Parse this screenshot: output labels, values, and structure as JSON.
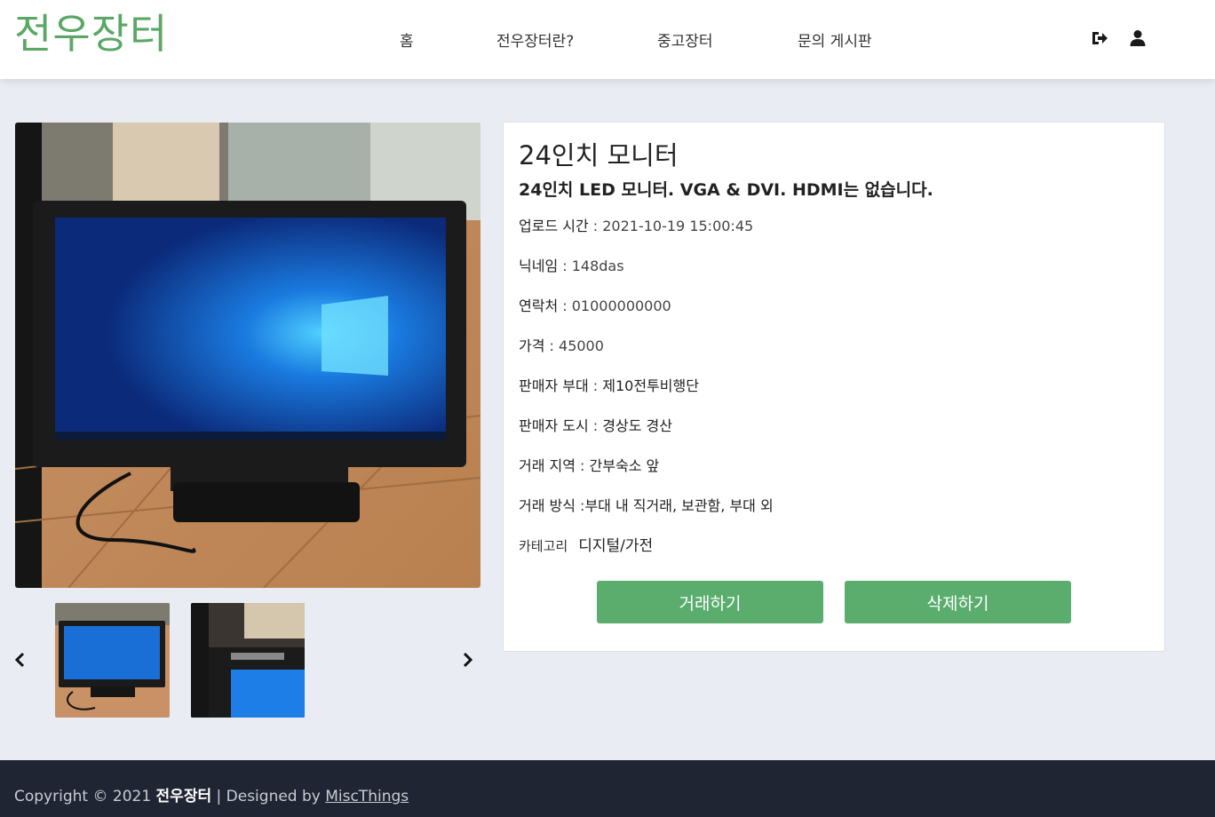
{
  "header": {
    "logo": "전우장터",
    "nav": [
      {
        "label": "홈"
      },
      {
        "label": "전우장터란?"
      },
      {
        "label": "중고장터"
      },
      {
        "label": "문의 게시판"
      }
    ],
    "icons": [
      "logout-icon",
      "user-icon"
    ]
  },
  "gallery": {
    "thumbnails": [
      "monitor-photo-1",
      "monitor-photo-2"
    ],
    "prev_icon": "chevron-left-icon",
    "next_icon": "chevron-right-icon"
  },
  "product": {
    "title": "24인치 모니터",
    "subtitle": "24인치 LED 모니터. VGA & DVI. HDMI는 없습니다.",
    "fields": [
      {
        "label": "업로드 시간",
        "sep": " : ",
        "value": "2021-10-19 15:00:45"
      },
      {
        "label": "닉네임",
        "sep": " : ",
        "value": "148das"
      },
      {
        "label": "연락처",
        "sep": " : ",
        "value": "01000000000"
      },
      {
        "label": "가격",
        "sep": " : ",
        "value": "45000"
      },
      {
        "label": "판매자 부대",
        "sep": " : ",
        "value": "제10전투비행단"
      },
      {
        "label": "판매자 도시",
        "sep": " : ",
        "value": "경상도 경산"
      },
      {
        "label": "거래 지역",
        "sep": " : ",
        "value": "간부숙소 앞"
      },
      {
        "label": "거래 방식",
        "sep": " :",
        "value": "부대 내 직거래, 보관함, 부대 외"
      }
    ],
    "category_label": "카테고리",
    "category_value": "디지털/가전",
    "trade_button": "거래하기",
    "delete_button": "삭제하기"
  },
  "footer": {
    "prefix": "Copyright © 2021 ",
    "brand": "전우장터",
    "middle": " | Designed by ",
    "link": "MiscThings"
  },
  "colors": {
    "accent": "#5aad6d",
    "logo": "#5aa766",
    "background": "#e9edf3",
    "footer": "#1f2532"
  }
}
